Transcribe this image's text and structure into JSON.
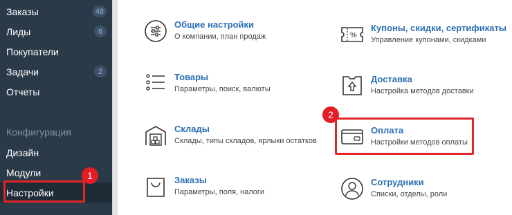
{
  "sidebar": {
    "items": [
      {
        "label": "Заказы",
        "badge": "48"
      },
      {
        "label": "Лиды",
        "badge": "6"
      },
      {
        "label": "Покупатели",
        "badge": null
      },
      {
        "label": "Задачи",
        "badge": "2"
      },
      {
        "label": "Отчеты",
        "badge": null
      }
    ],
    "section_title": "Конфигурация",
    "config_items": [
      {
        "label": "Дизайн"
      },
      {
        "label": "Модули"
      },
      {
        "label": "Настройки"
      }
    ]
  },
  "steps": {
    "one": "1",
    "two": "2"
  },
  "tiles": [
    {
      "title": "Общие настройки",
      "desc": "О компании, план продаж",
      "icon": "sliders-icon"
    },
    {
      "title": "Купоны, скидки, сертификаты",
      "desc": "Управление купонами, скидками",
      "icon": "coupon-icon"
    },
    {
      "title": "Товары",
      "desc": "Параметры, поиск, валюты",
      "icon": "list-icon"
    },
    {
      "title": "Доставка",
      "desc": "Настройка методов доставки",
      "icon": "box-icon"
    },
    {
      "title": "Склады",
      "desc": "Склады, типы складов, ярлыки остатков",
      "icon": "warehouse-icon"
    },
    {
      "title": "Оплата",
      "desc": "Настройки методов оплаты",
      "icon": "card-icon"
    },
    {
      "title": "Заказы",
      "desc": "Параметры, поля, налоги",
      "icon": "bag-icon"
    },
    {
      "title": "Сотрудники",
      "desc": "Списки, отделы, роли",
      "icon": "user-icon"
    }
  ],
  "colors": {
    "sidebar": "#2b3a48",
    "accent": "#2a6fb5",
    "highlight": "#e02626"
  }
}
